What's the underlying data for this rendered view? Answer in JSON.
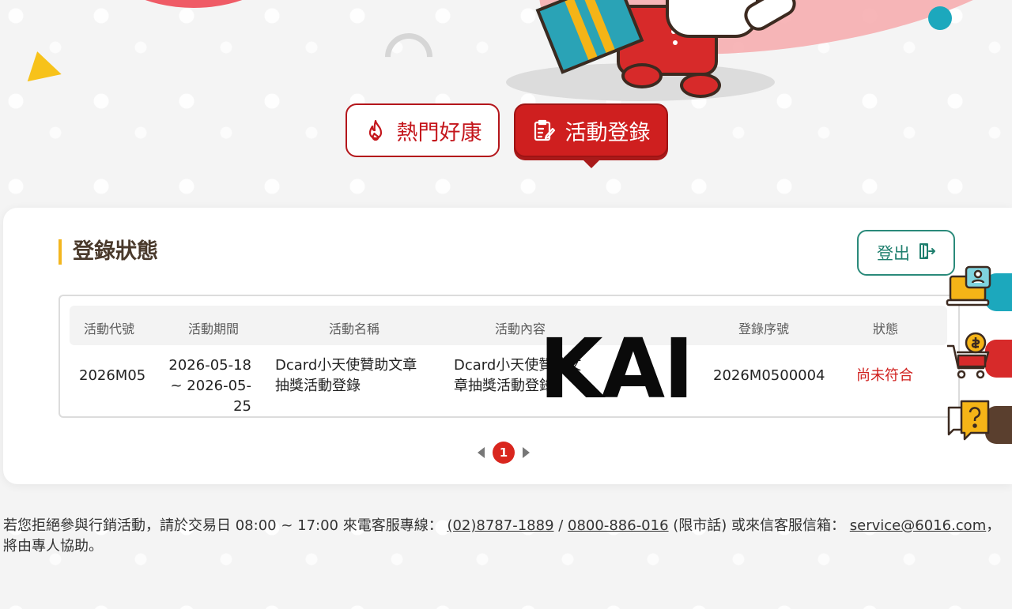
{
  "tabs": {
    "hot_label": "熱門好康",
    "register_label": "活動登錄"
  },
  "section": {
    "title": "登錄狀態"
  },
  "logout": {
    "label": "登出"
  },
  "table": {
    "headers": [
      "活動代號",
      "活動期間",
      "活動名稱",
      "活動內容",
      "登錄序號",
      "狀態"
    ],
    "rows": [
      {
        "code": "2026M05",
        "period_start": "2026-05-18",
        "period_end": "~ 2026-05-25",
        "name_line1": "Dcard小天使贊助文章",
        "name_line2": "抽獎活動登錄",
        "content_line1": "Dcard小天使贊助文",
        "content_line2": "章抽獎活動登錄",
        "serial": "2026M0500004",
        "status": "尚未符合"
      }
    ]
  },
  "pagination": {
    "current_page": "1"
  },
  "watermark": "KAI",
  "footer": {
    "text_before": "若您拒絕參與行銷活動，請於交易日 08:00 ~ 17:00 來電客服專線：",
    "phone1": "(02)8787-1889",
    "separator": " / ",
    "phone2": "0800-886-016",
    "phone2_note": " (限市話) 或來信客服信箱：",
    "email": "service@6016.com",
    "text_after": "，將由專人協助。"
  },
  "colors": {
    "brand_red": "#cf1f1f",
    "accent_yellow": "#f3b61f",
    "logout_green": "#1f7f6e",
    "status_red": "#d0201e"
  },
  "icons": [
    "fire-icon",
    "edit-checklist-icon",
    "logout-icon",
    "customer-service-icon",
    "cart-coin-icon",
    "question-chat-icon"
  ]
}
